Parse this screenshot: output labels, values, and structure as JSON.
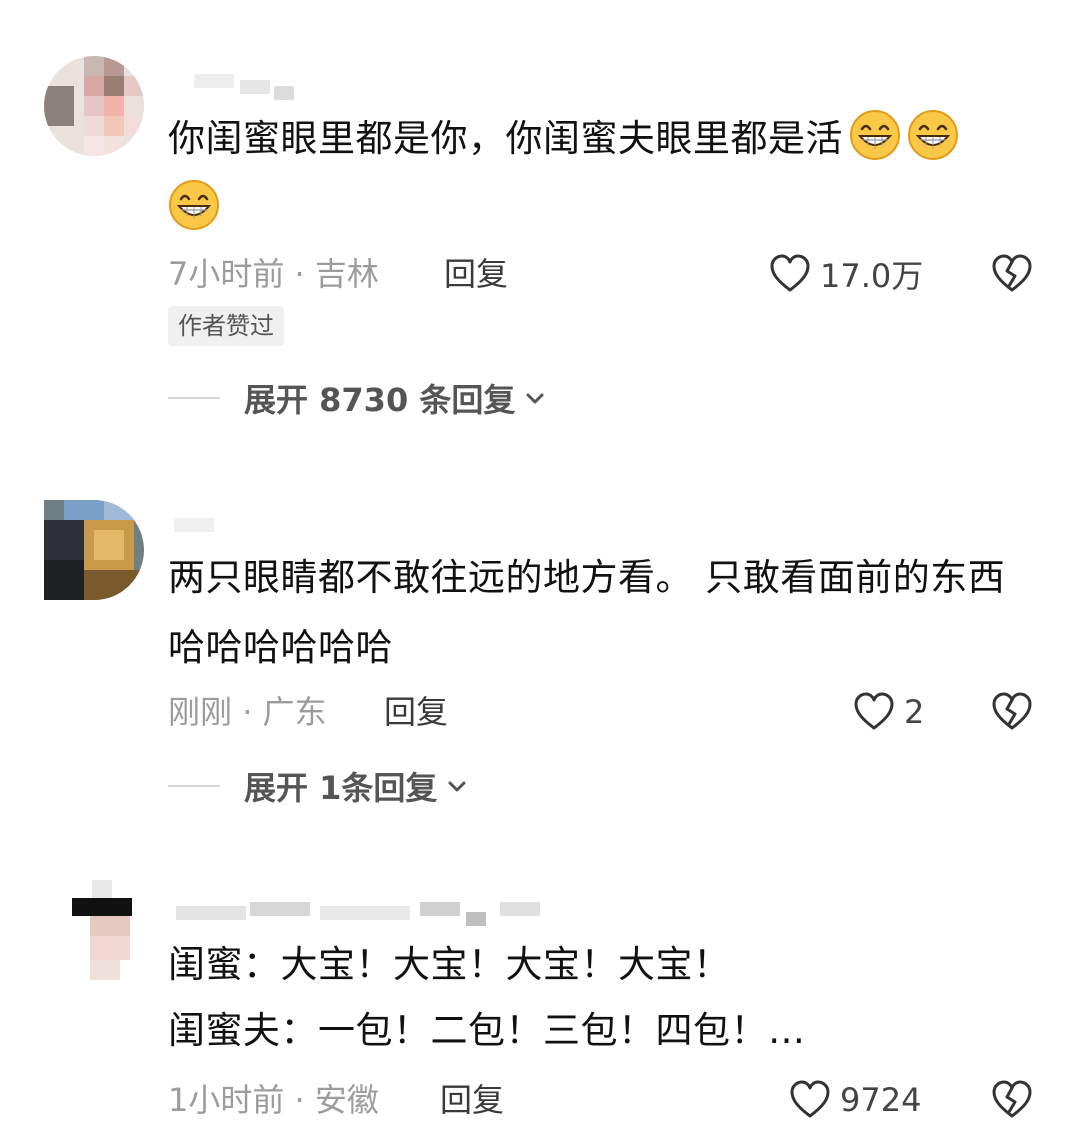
{
  "comments": [
    {
      "text": "你闺蜜眼里都是你，你闺蜜夫眼里都是活",
      "time": "7小时前",
      "location": "吉林",
      "reply_label": "回复",
      "likes": "17.0万",
      "badge": "作者赞过",
      "expand_label": "展开 8730 条回复",
      "emoji": [
        "grinning-face-icon",
        "grinning-face-icon",
        "grinning-face-icon"
      ]
    },
    {
      "text": "两只眼睛都不敢往远的地方看。 只敢看面前的东西哈哈哈哈哈哈",
      "time": "刚刚",
      "location": "广东",
      "reply_label": "回复",
      "likes": "2",
      "expand_label": "展开 1条回复"
    },
    {
      "line1": "闺蜜：大宝！大宝！大宝！大宝！",
      "line2": "闺蜜夫：一包！二包！三包！四包！…",
      "time": "1小时前",
      "location": "安徽",
      "reply_label": "回复",
      "likes": "9724"
    }
  ],
  "meta_separator": " · ",
  "colors": {
    "accent_emoji": "#f6b93b",
    "meta_gray": "#9c9c9c",
    "text": "#111111"
  }
}
